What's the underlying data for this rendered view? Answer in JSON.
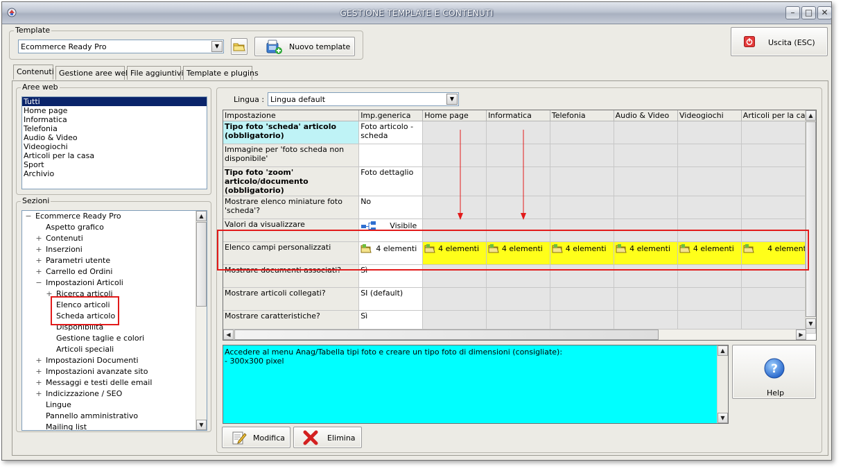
{
  "window": {
    "title": "GESTIONE TEMPLATE E CONTENUTI",
    "controls": [
      "minimize",
      "maximize",
      "close"
    ]
  },
  "template": {
    "group_label": "Template",
    "selected": "Ecommerce Ready Pro",
    "new_button": "Nuovo template"
  },
  "exit_button": "Uscita (ESC)",
  "tabs": [
    "Contenuti",
    "Gestione aree web",
    "File aggiuntivi",
    "Template e plugins"
  ],
  "aree_web": {
    "label": "Aree web",
    "items": [
      "Tutti",
      "Home page",
      "Informatica",
      "Telefonia",
      "Audio & Video",
      "Videogiochi",
      "Articoli per la casa",
      "Sport",
      "Archivio"
    ],
    "selected": "Tutti"
  },
  "sezioni": {
    "label": "Sezioni",
    "nodes": [
      {
        "text": "Ecommerce Ready Pro",
        "level": 0,
        "expander": "−"
      },
      {
        "text": "Aspetto grafico",
        "level": 1,
        "expander": ""
      },
      {
        "text": "Contenuti",
        "level": 1,
        "expander": "+"
      },
      {
        "text": "Inserzioni",
        "level": 1,
        "expander": "+"
      },
      {
        "text": "Parametri utente",
        "level": 1,
        "expander": "+"
      },
      {
        "text": "Carrello ed Ordini",
        "level": 1,
        "expander": "+"
      },
      {
        "text": "Impostazioni Articoli",
        "level": 1,
        "expander": "−"
      },
      {
        "text": "Ricerca articoli",
        "level": 2,
        "expander": "+"
      },
      {
        "text": "Elenco articoli",
        "level": 2,
        "expander": ""
      },
      {
        "text": "Scheda articolo",
        "level": 2,
        "expander": ""
      },
      {
        "text": "Disponibilità",
        "level": 2,
        "expander": ""
      },
      {
        "text": "Gestione taglie e colori",
        "level": 2,
        "expander": ""
      },
      {
        "text": "Articoli speciali",
        "level": 2,
        "expander": ""
      },
      {
        "text": "Impostazioni Documenti",
        "level": 1,
        "expander": "+"
      },
      {
        "text": "Impostazioni avanzate sito",
        "level": 1,
        "expander": "+"
      },
      {
        "text": "Messaggi e testi delle email",
        "level": 1,
        "expander": "+"
      },
      {
        "text": "Indicizzazione / SEO",
        "level": 1,
        "expander": "+"
      },
      {
        "text": "Lingue",
        "level": 1,
        "expander": ""
      },
      {
        "text": "Pannello amministrativo",
        "level": 1,
        "expander": ""
      },
      {
        "text": "Mailing list",
        "level": 1,
        "expander": ""
      }
    ]
  },
  "lingua": {
    "label": "Lingua :",
    "selected": "Lingua default"
  },
  "grid": {
    "columns": [
      "Impostazione",
      "Imp.generica",
      "Home page",
      "Informatica",
      "Telefonia",
      "Audio & Video",
      "Videogiochi",
      "Articoli per la casa"
    ],
    "rows": [
      {
        "label": "Tipo foto 'scheda' articolo (obbligatorio)",
        "style": "hl",
        "generic": "Foto articolo - scheda",
        "others": "",
        "icon": ""
      },
      {
        "label": "Immagine per 'foto scheda non disponibile'",
        "style": "",
        "generic": "",
        "others": "",
        "icon": ""
      },
      {
        "label": "Tipo foto 'zoom' articolo/documento (obbligatorio)",
        "style": "bold",
        "generic": "Foto dettaglio",
        "others": "",
        "icon": ""
      },
      {
        "label": "Mostrare elenco miniature foto 'scheda'?",
        "style": "",
        "generic": "No",
        "others": "",
        "icon": ""
      },
      {
        "label": "Valori da visualizzare",
        "style": "",
        "generic": "Visibile",
        "others": "",
        "icon": "tree"
      },
      {
        "label": "Elenco campi personalizzati",
        "style": "",
        "generic": "4 elementi",
        "others": "4 elementi",
        "icon": "folder"
      },
      {
        "label": "Mostrare documenti associati?",
        "style": "",
        "generic": "Sì",
        "others": "",
        "icon": ""
      },
      {
        "label": "Mostrare articoli collegati?",
        "style": "",
        "generic": "SI (default)",
        "others": "",
        "icon": ""
      },
      {
        "label": "Mostrare caratteristiche?",
        "style": "",
        "generic": "Sì",
        "others": "",
        "icon": ""
      }
    ]
  },
  "description": {
    "lines": [
      "Accedere al menu Anag/Tabella tipi foto e creare un tipo foto di dimensioni (consigliate):",
      "- 300x300 pixel"
    ]
  },
  "buttons": {
    "help": "Help",
    "modifica": "Modifica",
    "elimina": "Elimina"
  },
  "colors": {
    "highlight_row": "#ffff1a",
    "description_bg": "#00ffff",
    "annotation": "#e21a1a",
    "selected_header_cell": "#bff3f6"
  }
}
